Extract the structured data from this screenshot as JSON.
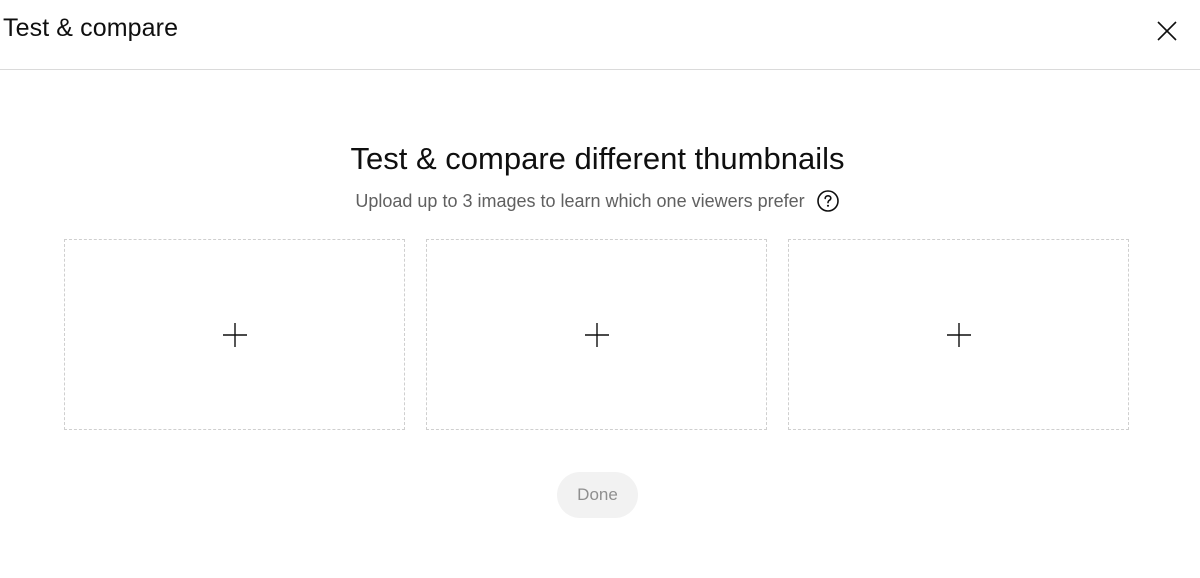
{
  "dialog": {
    "title": "Test & compare",
    "close_icon": "close-icon"
  },
  "main": {
    "heading": "Test & compare different thumbnails",
    "subheading": "Upload up to 3 images to learn which one viewers prefer",
    "help_icon": "help-circle-icon"
  },
  "slots": [
    {
      "icon": "plus-icon",
      "state": "empty"
    },
    {
      "icon": "plus-icon",
      "state": "empty"
    },
    {
      "icon": "plus-icon",
      "state": "empty"
    }
  ],
  "footer": {
    "done_label": "Done",
    "done_enabled": false
  },
  "colors": {
    "text_primary": "#0f0f0f",
    "text_secondary": "#606060",
    "button_disabled_bg": "#f2f2f2",
    "button_disabled_text": "#8f8f8f",
    "divider": "#dadada",
    "dashed_border": "#cfcfcf"
  }
}
